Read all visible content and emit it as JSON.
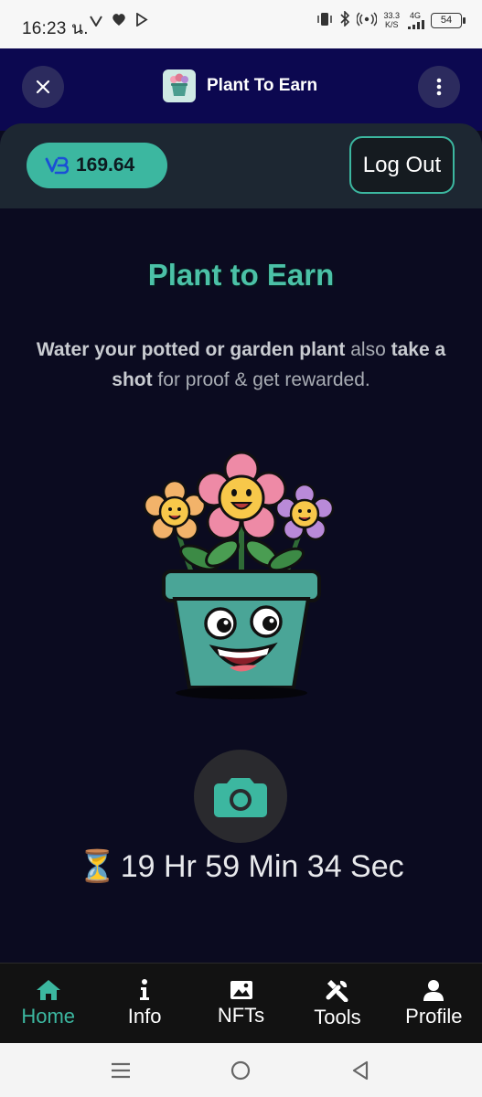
{
  "status_bar": {
    "time": "16:23 น.",
    "net_speed_value": "33.3",
    "net_speed_unit": "K/S",
    "network": "4G",
    "battery": "54"
  },
  "app_header": {
    "title": "Plant To Earn",
    "logo_text": "Plant to Earn"
  },
  "account": {
    "balance": "169.64",
    "currency_icon": "vb-coin-icon",
    "logout_label": "Log Out"
  },
  "main": {
    "heading": "Plant to Earn",
    "description": {
      "part1": "Water your potted or garden plant",
      "part2": " also ",
      "part3": "take a shot",
      "part4": " for proof & get rewarded."
    },
    "timer_icon": "⏳",
    "timer": "19 Hr 59 Min 34 Sec"
  },
  "bottom_nav": [
    {
      "label": "Home",
      "icon": "home-icon",
      "active": true
    },
    {
      "label": "Info",
      "icon": "info-icon",
      "active": false
    },
    {
      "label": "NFTs",
      "icon": "image-icon",
      "active": false
    },
    {
      "label": "Tools",
      "icon": "tools-icon",
      "active": false
    },
    {
      "label": "Profile",
      "icon": "person-icon",
      "active": false
    }
  ],
  "colors": {
    "accent": "#3cb7a0",
    "header_bg": "#0c0850",
    "page_bg": "#0b0b20"
  }
}
